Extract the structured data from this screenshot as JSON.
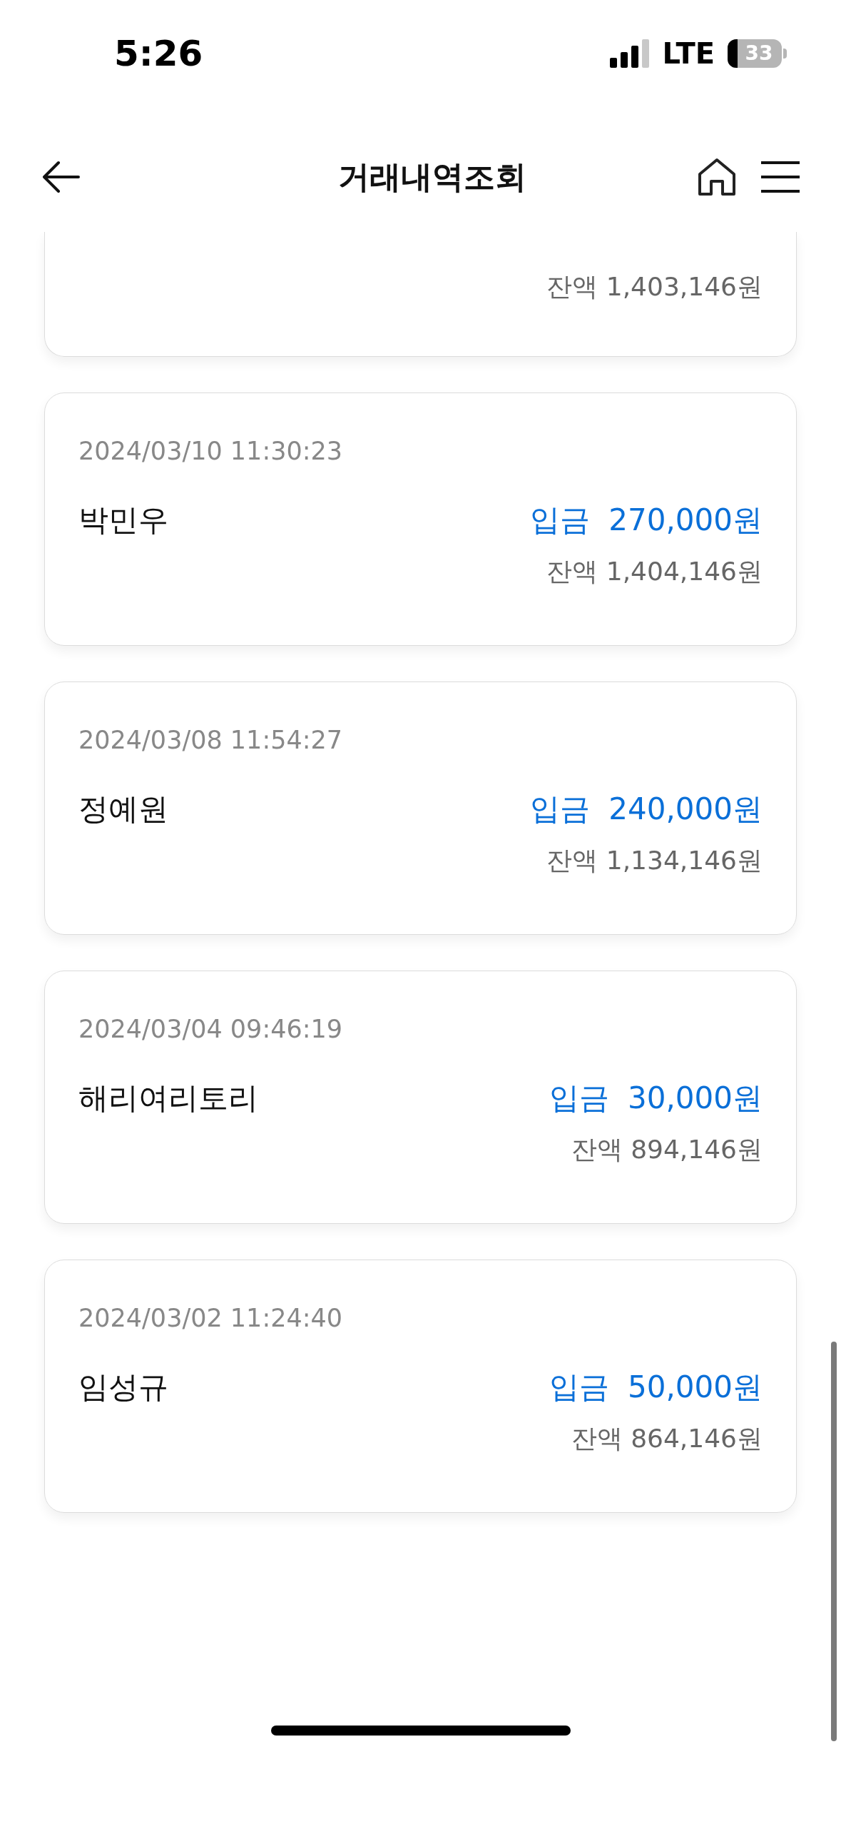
{
  "status_bar": {
    "time": "5:26",
    "network": "LTE",
    "battery": "33"
  },
  "header": {
    "title": "거래내역조회"
  },
  "partial_card": {
    "balance": "잔액 1,403,146원"
  },
  "transactions": [
    {
      "datetime": "2024/03/10 11:30:23",
      "name": "박민우",
      "kind": "deposit",
      "type_label": "입금",
      "amount": "270,000원",
      "balance": "잔액 1,404,146원"
    },
    {
      "datetime": "2024/03/08 11:54:27",
      "name": "정예원",
      "kind": "deposit",
      "type_label": "입금",
      "amount": "240,000원",
      "balance": "잔액 1,134,146원"
    },
    {
      "datetime": "2024/03/04 09:46:19",
      "name": "해리여리토리",
      "kind": "deposit",
      "type_label": "입금",
      "amount": "30,000원",
      "balance": "잔액 894,146원"
    },
    {
      "datetime": "2024/03/02 11:24:40",
      "name": "임성규",
      "kind": "deposit",
      "type_label": "입금",
      "amount": "50,000원",
      "balance": "잔액 864,146원"
    }
  ]
}
